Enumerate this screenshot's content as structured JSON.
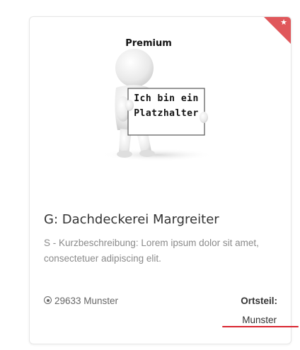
{
  "card": {
    "image": {
      "premium_label": "Premium",
      "sign_line1": "Ich bin ein",
      "sign_line2": "Platzhalter"
    },
    "badge_icon": "star-icon",
    "title": "G: Dachdeckerei Margreiter",
    "description": "S - Kurzbeschreibung: Lorem ipsum dolor sit amet, consectetuer adipiscing elit.",
    "location": {
      "icon": "location-pin-icon",
      "text": "29633 Munster"
    },
    "ortsteil": {
      "label": "Ortsteil:",
      "value": "Munster"
    }
  },
  "colors": {
    "ribbon": "#e0575b",
    "underline": "#d9232e",
    "title": "#333333",
    "description": "#8a8a8a"
  }
}
